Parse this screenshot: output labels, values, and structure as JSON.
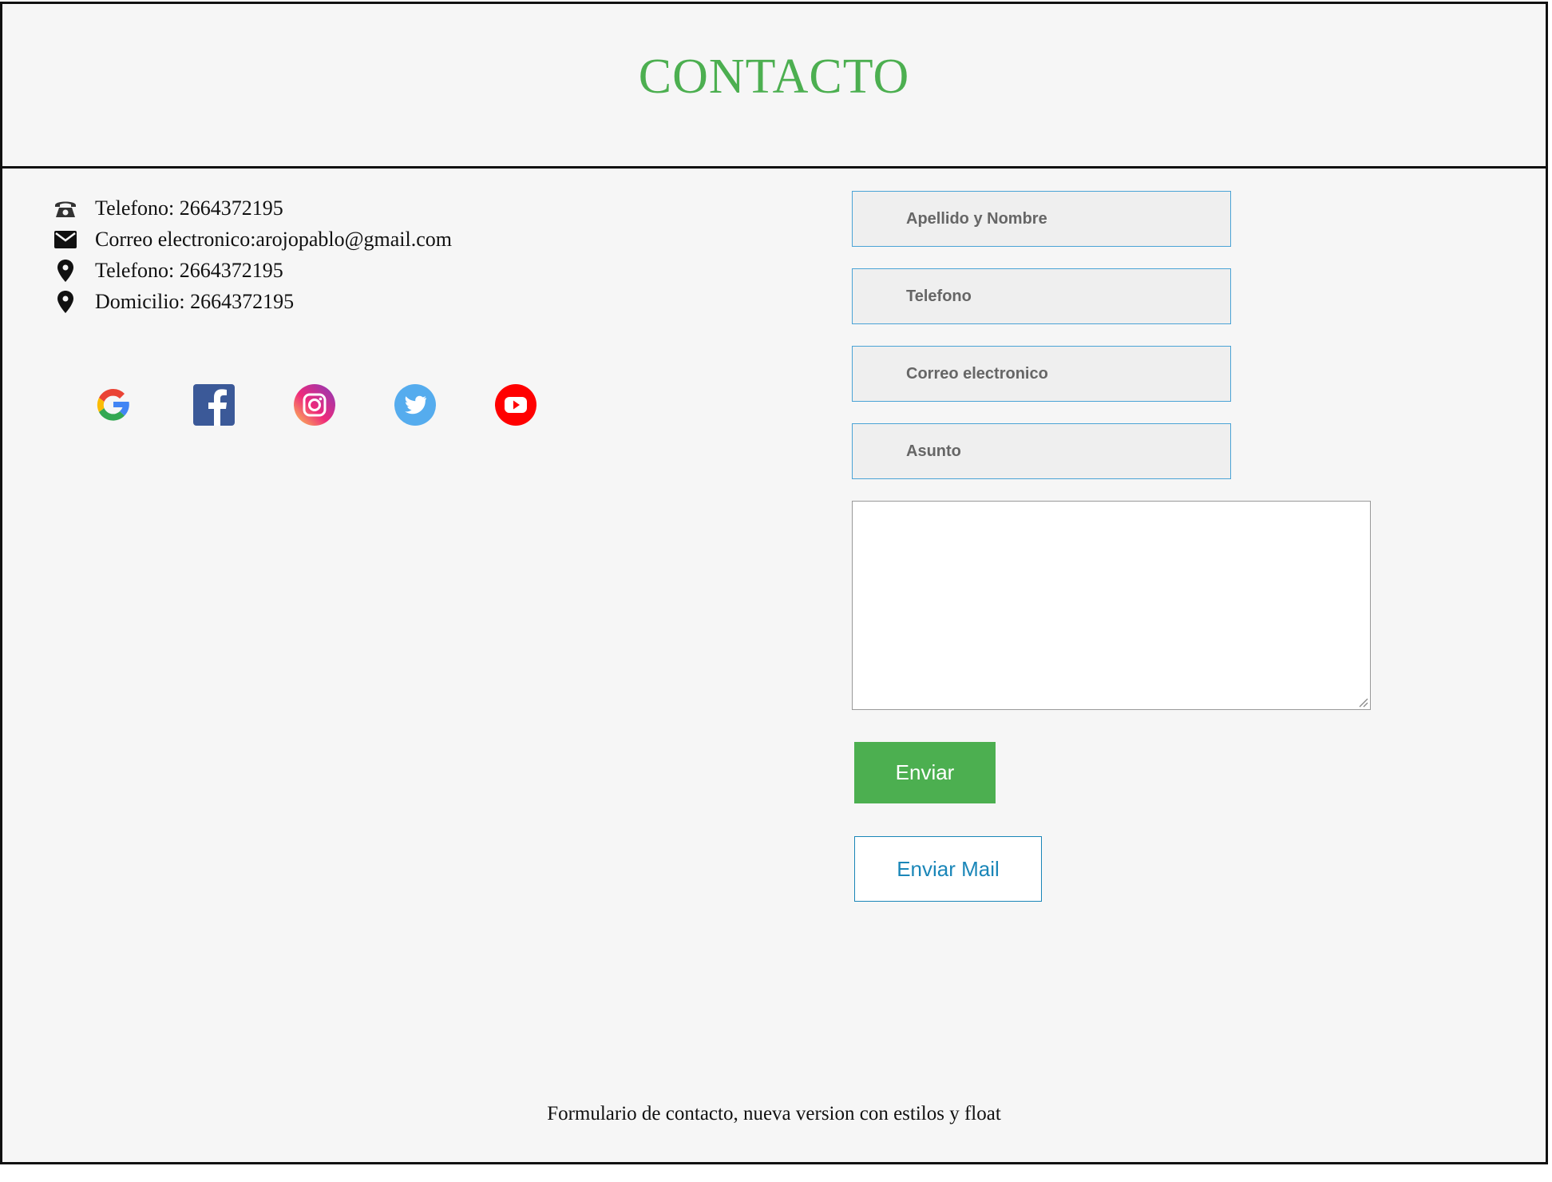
{
  "header": {
    "title": "CONTACTO"
  },
  "info": [
    {
      "icon": "phone-icon",
      "text": "Telefono: 2664372195"
    },
    {
      "icon": "mail-icon",
      "text": "Correo electronico:arojopablo@gmail.com"
    },
    {
      "icon": "location-pin-icon",
      "text": "Telefono: 2664372195"
    },
    {
      "icon": "location-pin-icon",
      "text": "Domicilio: 2664372195"
    }
  ],
  "social": [
    "google-icon",
    "facebook-icon",
    "instagram-icon",
    "twitter-icon",
    "youtube-icon"
  ],
  "form": {
    "name_placeholder": "Apellido y Nombre",
    "phone_placeholder": "Telefono",
    "email_placeholder": "Correo electronico",
    "subject_placeholder": "Asunto",
    "message_value": "",
    "send_label": "Enviar",
    "mail_label": "Enviar Mail"
  },
  "colors": {
    "accent": "#4caf50",
    "link": "#1a86b8",
    "field_border": "#4aa3d6"
  },
  "footer": {
    "text": "Formulario de contacto, nueva version con estilos y float"
  }
}
